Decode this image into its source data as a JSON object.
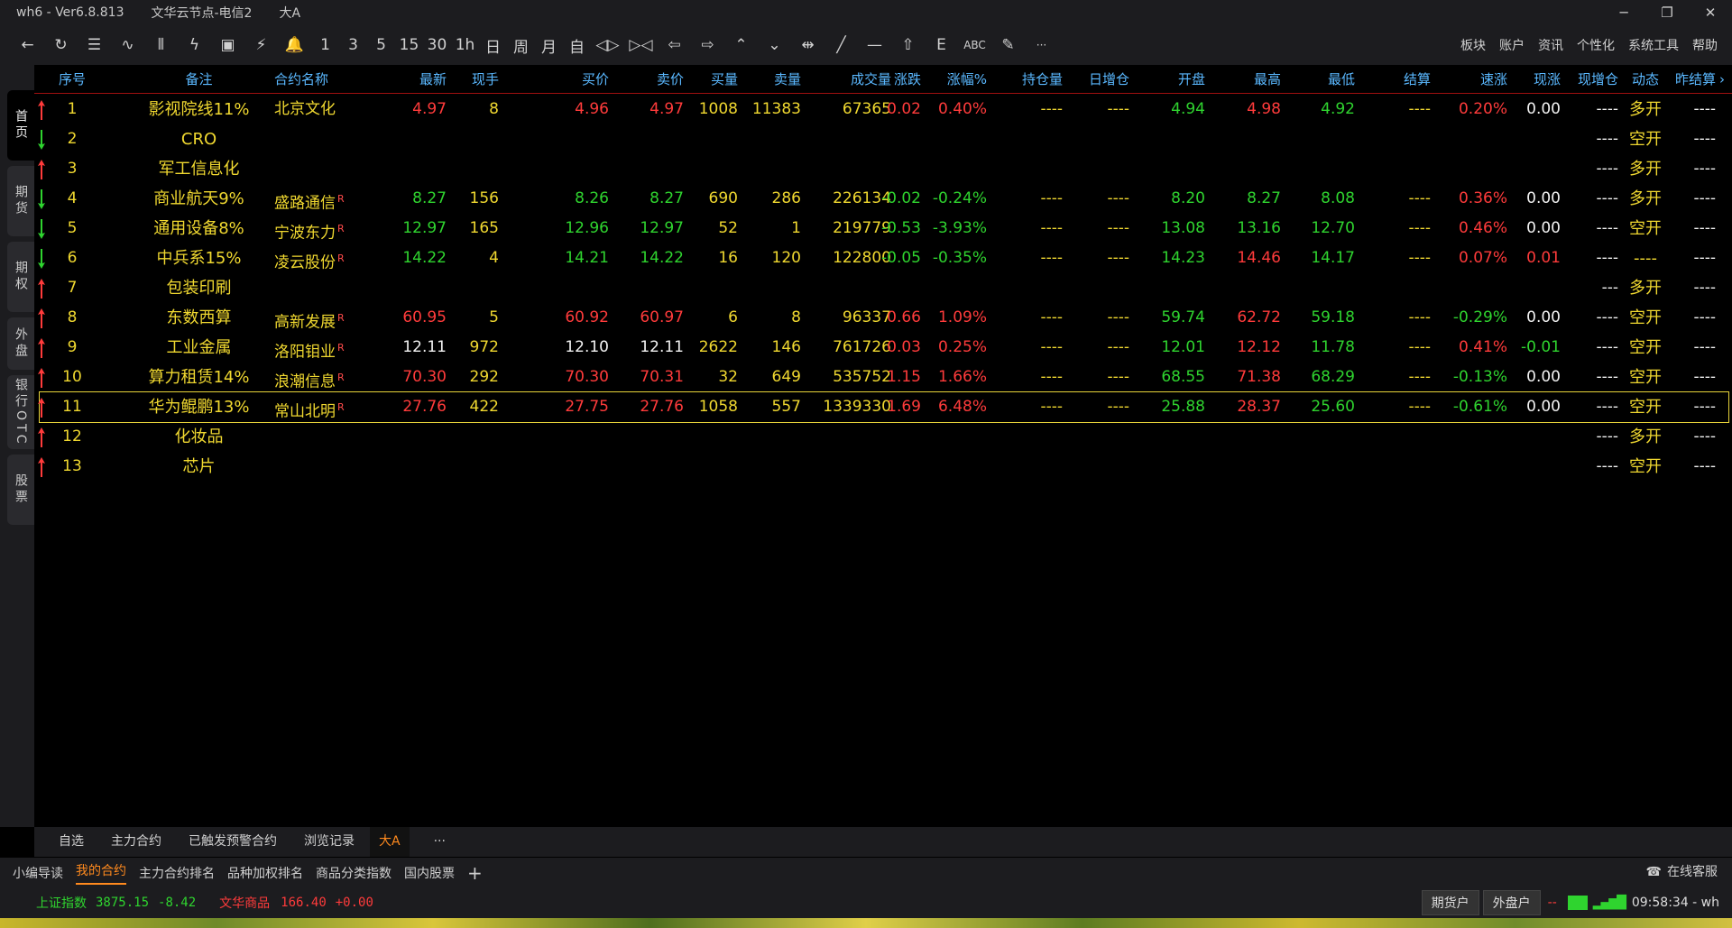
{
  "window": {
    "app": "wh6",
    "version": "Ver6.8.813",
    "server": "文华云节点-电信2",
    "page": "大A",
    "controls": [
      "─",
      "❐",
      "✕"
    ]
  },
  "toolbar": {
    "icons": [
      {
        "name": "back-icon",
        "glyph": "←"
      },
      {
        "name": "refresh-icon",
        "glyph": "↻"
      },
      {
        "name": "list-icon",
        "glyph": "☰"
      },
      {
        "name": "line-chart-icon",
        "glyph": "∿"
      },
      {
        "name": "candlestick-icon",
        "glyph": "⫴"
      },
      {
        "name": "flash-chart-icon",
        "glyph": "ϟ"
      },
      {
        "name": "f10-icon",
        "glyph": "▣"
      },
      {
        "name": "lightning-icon",
        "glyph": "⚡"
      },
      {
        "name": "bell-icon",
        "glyph": "🔔"
      }
    ],
    "periods": [
      "1",
      "3",
      "5",
      "15",
      "30",
      "1h",
      "日",
      "周",
      "月",
      "自"
    ],
    "draw_icons": [
      {
        "name": "zoom-in-icon",
        "glyph": "◁▷"
      },
      {
        "name": "zoom-out-icon",
        "glyph": "▷◁"
      },
      {
        "name": "arrow-left-icon",
        "glyph": "⇦"
      },
      {
        "name": "arrow-right-icon",
        "glyph": "⇨"
      },
      {
        "name": "double-up-icon",
        "glyph": "⌃"
      },
      {
        "name": "double-down-icon",
        "glyph": "⌄"
      },
      {
        "name": "crosshair-icon",
        "glyph": "⇹"
      },
      {
        "name": "draw-line-icon",
        "glyph": "╱"
      },
      {
        "name": "horizontal-line-icon",
        "glyph": "—"
      },
      {
        "name": "up-arrow-icon",
        "glyph": "⇧"
      },
      {
        "name": "text-e-icon",
        "glyph": "Ε"
      },
      {
        "name": "abc-icon",
        "glyph": "ABC"
      },
      {
        "name": "pen-icon",
        "glyph": "✎"
      },
      {
        "name": "more-icon",
        "glyph": "···"
      }
    ],
    "menu": [
      "板块",
      "账户",
      "资讯",
      "个性化",
      "系统工具",
      "帮助"
    ]
  },
  "left_tabs": [
    {
      "label": "首页",
      "active": true
    },
    {
      "label": "期货",
      "active": false
    },
    {
      "label": "期权",
      "active": false
    },
    {
      "label": "外盘",
      "active": false
    },
    {
      "label": "银行OTC",
      "active": false
    },
    {
      "label": "股票",
      "active": false
    }
  ],
  "columns": [
    "序号",
    "备注",
    "合约名称",
    "最新",
    "现手",
    "买价",
    "卖价",
    "买量",
    "卖量",
    "成交量",
    "涨跌",
    "涨幅%",
    "持仓量",
    "日增仓",
    "开盘",
    "最高",
    "最低",
    "结算",
    "速涨",
    "现涨",
    "现增仓",
    "动态",
    "昨结算"
  ],
  "columns_more": "›",
  "rows": [
    {
      "dir": "up",
      "no": "1",
      "note": "影视院线11%",
      "name": "北京文化",
      "r": "",
      "last": "4.97",
      "vol_now": "8",
      "bid": "4.96",
      "ask": "4.97",
      "bid_vol": "1008",
      "ask_vol": "11383",
      "volume": "67365",
      "chg": "0.02",
      "chg_pct": "0.40%",
      "oi": "----",
      "oi_day": "----",
      "open": "4.94",
      "high": "4.98",
      "low": "4.92",
      "settle": "----",
      "speed": "0.20%",
      "cur_chg": "0.00",
      "cur_oi": "----",
      "dyn": "多开",
      "prev_settle": "----",
      "c": {
        "last": "red",
        "bid": "red",
        "ask": "red",
        "chg": "red",
        "open": "green",
        "high": "red",
        "low": "green",
        "speed": "red",
        "cur_chg": "white"
      }
    },
    {
      "dir": "down",
      "no": "2",
      "note": "CRO",
      "name": "",
      "r": "",
      "last": "",
      "vol_now": "",
      "bid": "",
      "ask": "",
      "bid_vol": "",
      "ask_vol": "",
      "volume": "",
      "chg": "",
      "chg_pct": "",
      "oi": "",
      "oi_day": "",
      "open": "",
      "high": "",
      "low": "",
      "settle": "",
      "speed": "",
      "cur_chg": "",
      "cur_oi": "----",
      "dyn": "空开",
      "prev_settle": "----",
      "c": {}
    },
    {
      "dir": "up",
      "no": "3",
      "note": "军工信息化",
      "name": "",
      "r": "",
      "last": "",
      "vol_now": "",
      "bid": "",
      "ask": "",
      "bid_vol": "",
      "ask_vol": "",
      "volume": "",
      "chg": "",
      "chg_pct": "",
      "oi": "",
      "oi_day": "",
      "open": "",
      "high": "",
      "low": "",
      "settle": "",
      "speed": "",
      "cur_chg": "",
      "cur_oi": "----",
      "dyn": "多开",
      "prev_settle": "----",
      "c": {}
    },
    {
      "dir": "down",
      "no": "4",
      "note": "商业航天9%",
      "name": "盛路通信",
      "r": "R",
      "last": "8.27",
      "vol_now": "156",
      "bid": "8.26",
      "ask": "8.27",
      "bid_vol": "690",
      "ask_vol": "286",
      "volume": "226134",
      "chg": "-0.02",
      "chg_pct": "-0.24%",
      "oi": "----",
      "oi_day": "----",
      "open": "8.20",
      "high": "8.27",
      "low": "8.08",
      "settle": "----",
      "speed": "0.36%",
      "cur_chg": "0.00",
      "cur_oi": "----",
      "dyn": "多开",
      "prev_settle": "----",
      "c": {
        "last": "green",
        "bid": "green",
        "ask": "green",
        "chg": "green",
        "open": "green",
        "high": "green",
        "low": "green",
        "speed": "red",
        "cur_chg": "white"
      }
    },
    {
      "dir": "down",
      "no": "5",
      "note": "通用设备8%",
      "name": "宁波东力",
      "r": "R",
      "last": "12.97",
      "vol_now": "165",
      "bid": "12.96",
      "ask": "12.97",
      "bid_vol": "52",
      "ask_vol": "1",
      "volume": "219779",
      "chg": "-0.53",
      "chg_pct": "-3.93%",
      "oi": "----",
      "oi_day": "----",
      "open": "13.08",
      "high": "13.16",
      "low": "12.70",
      "settle": "----",
      "speed": "0.46%",
      "cur_chg": "0.00",
      "cur_oi": "----",
      "dyn": "空开",
      "prev_settle": "----",
      "c": {
        "last": "green",
        "bid": "green",
        "ask": "green",
        "chg": "green",
        "open": "green",
        "high": "green",
        "low": "green",
        "speed": "red",
        "cur_chg": "white"
      }
    },
    {
      "dir": "down",
      "no": "6",
      "note": "中兵系15%",
      "name": "凌云股份",
      "r": "R",
      "last": "14.22",
      "vol_now": "4",
      "bid": "14.21",
      "ask": "14.22",
      "bid_vol": "16",
      "ask_vol": "120",
      "volume": "122800",
      "chg": "-0.05",
      "chg_pct": "-0.35%",
      "oi": "----",
      "oi_day": "----",
      "open": "14.23",
      "high": "14.46",
      "low": "14.17",
      "settle": "----",
      "speed": "0.07%",
      "cur_chg": "0.01",
      "cur_oi": "----",
      "dyn": "----",
      "prev_settle": "----",
      "c": {
        "last": "green",
        "bid": "green",
        "ask": "green",
        "chg": "green",
        "open": "green",
        "high": "red",
        "low": "green",
        "speed": "red",
        "cur_chg": "red"
      }
    },
    {
      "dir": "up",
      "no": "7",
      "note": "包装印刷",
      "name": "",
      "r": "",
      "last": "",
      "vol_now": "",
      "bid": "",
      "ask": "",
      "bid_vol": "",
      "ask_vol": "",
      "volume": "",
      "chg": "",
      "chg_pct": "",
      "oi": "",
      "oi_day": "",
      "open": "",
      "high": "",
      "low": "",
      "settle": "",
      "speed": "",
      "cur_chg": "",
      "cur_oi": "---",
      "dyn": "多开",
      "prev_settle": "----",
      "c": {}
    },
    {
      "dir": "up",
      "no": "8",
      "note": "东数西算",
      "name": "高新发展",
      "r": "R",
      "last": "60.95",
      "vol_now": "5",
      "bid": "60.92",
      "ask": "60.97",
      "bid_vol": "6",
      "ask_vol": "8",
      "volume": "96337",
      "chg": "0.66",
      "chg_pct": "1.09%",
      "oi": "----",
      "oi_day": "----",
      "open": "59.74",
      "high": "62.72",
      "low": "59.18",
      "settle": "----",
      "speed": "-0.29%",
      "cur_chg": "0.00",
      "cur_oi": "----",
      "dyn": "空开",
      "prev_settle": "----",
      "c": {
        "last": "red",
        "bid": "red",
        "ask": "red",
        "chg": "red",
        "open": "green",
        "high": "red",
        "low": "green",
        "speed": "green",
        "cur_chg": "white"
      }
    },
    {
      "dir": "up",
      "no": "9",
      "note": "工业金属",
      "name": "洛阳钼业",
      "r": "R",
      "last": "12.11",
      "vol_now": "972",
      "bid": "12.10",
      "ask": "12.11",
      "bid_vol": "2622",
      "ask_vol": "146",
      "volume": "761726",
      "chg": "0.03",
      "chg_pct": "0.25%",
      "oi": "----",
      "oi_day": "----",
      "open": "12.01",
      "high": "12.12",
      "low": "11.78",
      "settle": "----",
      "speed": "0.41%",
      "cur_chg": "-0.01",
      "cur_oi": "----",
      "dyn": "空开",
      "prev_settle": "----",
      "c": {
        "last": "white",
        "bid": "white",
        "ask": "white",
        "chg": "red",
        "open": "green",
        "high": "red",
        "low": "green",
        "speed": "red",
        "cur_chg": "green"
      }
    },
    {
      "dir": "up",
      "no": "10",
      "note": "算力租赁14%",
      "name": "浪潮信息",
      "r": "R",
      "last": "70.30",
      "vol_now": "292",
      "bid": "70.30",
      "ask": "70.31",
      "bid_vol": "32",
      "ask_vol": "649",
      "volume": "535752",
      "chg": "1.15",
      "chg_pct": "1.66%",
      "oi": "----",
      "oi_day": "----",
      "open": "68.55",
      "high": "71.38",
      "low": "68.29",
      "settle": "----",
      "speed": "-0.13%",
      "cur_chg": "0.00",
      "cur_oi": "----",
      "dyn": "空开",
      "prev_settle": "----",
      "c": {
        "last": "red",
        "bid": "red",
        "ask": "red",
        "chg": "red",
        "open": "green",
        "high": "red",
        "low": "green",
        "speed": "green",
        "cur_chg": "white"
      }
    },
    {
      "dir": "up",
      "no": "11",
      "note": "华为鲲鹏13%",
      "name": "常山北明",
      "r": "R",
      "last": "27.76",
      "vol_now": "422",
      "bid": "27.75",
      "ask": "27.76",
      "bid_vol": "1058",
      "ask_vol": "557",
      "volume": "1339330",
      "chg": "1.69",
      "chg_pct": "6.48%",
      "oi": "----",
      "oi_day": "----",
      "open": "25.88",
      "high": "28.37",
      "low": "25.60",
      "settle": "----",
      "speed": "-0.61%",
      "cur_chg": "0.00",
      "cur_oi": "----",
      "dyn": "空开",
      "prev_settle": "----",
      "selected": true,
      "c": {
        "last": "red",
        "bid": "red",
        "ask": "red",
        "chg": "red",
        "open": "green",
        "high": "red",
        "low": "green",
        "speed": "green",
        "cur_chg": "white"
      }
    },
    {
      "dir": "up",
      "no": "12",
      "note": "化妆品",
      "name": "",
      "r": "",
      "last": "",
      "vol_now": "",
      "bid": "",
      "ask": "",
      "bid_vol": "",
      "ask_vol": "",
      "volume": "",
      "chg": "",
      "chg_pct": "",
      "oi": "",
      "oi_day": "",
      "open": "",
      "high": "",
      "low": "",
      "settle": "",
      "speed": "",
      "cur_chg": "",
      "cur_oi": "----",
      "dyn": "多开",
      "prev_settle": "----",
      "c": {}
    },
    {
      "dir": "up",
      "no": "13",
      "note": "芯片",
      "name": "",
      "r": "",
      "last": "",
      "vol_now": "",
      "bid": "",
      "ask": "",
      "bid_vol": "",
      "ask_vol": "",
      "volume": "",
      "chg": "",
      "chg_pct": "",
      "oi": "",
      "oi_day": "",
      "open": "",
      "high": "",
      "low": "",
      "settle": "",
      "speed": "",
      "cur_chg": "",
      "cur_oi": "----",
      "dyn": "空开",
      "prev_settle": "----",
      "c": {}
    }
  ],
  "sheet_tabs": [
    "自选",
    "主力合约",
    "已触发预警合约",
    "浏览记录",
    "大A",
    "···"
  ],
  "sheet_tab_active": 4,
  "bottom_tabs": [
    "小编导读",
    "我的合约",
    "主力合约排名",
    "品种加权排名",
    "商品分类指数",
    "国内股票",
    "+"
  ],
  "bottom_tab_active": 1,
  "support": "在线客服",
  "status": {
    "index1_name": "上证指数",
    "index1_value": "3875.15",
    "index1_chg": "-8.42",
    "index2_name": "文华商品",
    "index2_value": "166.40",
    "index2_chg": "+0.00",
    "btn_futures": "期货户",
    "btn_foreign": "外盘户",
    "dash": "--",
    "time": "09:58:34 - wh"
  },
  "colors": {
    "up": "#ff3b3b",
    "down": "#2fd42f",
    "header": "#5ab8ff",
    "note": "#f0d830",
    "accent": "#ff8a1e"
  }
}
